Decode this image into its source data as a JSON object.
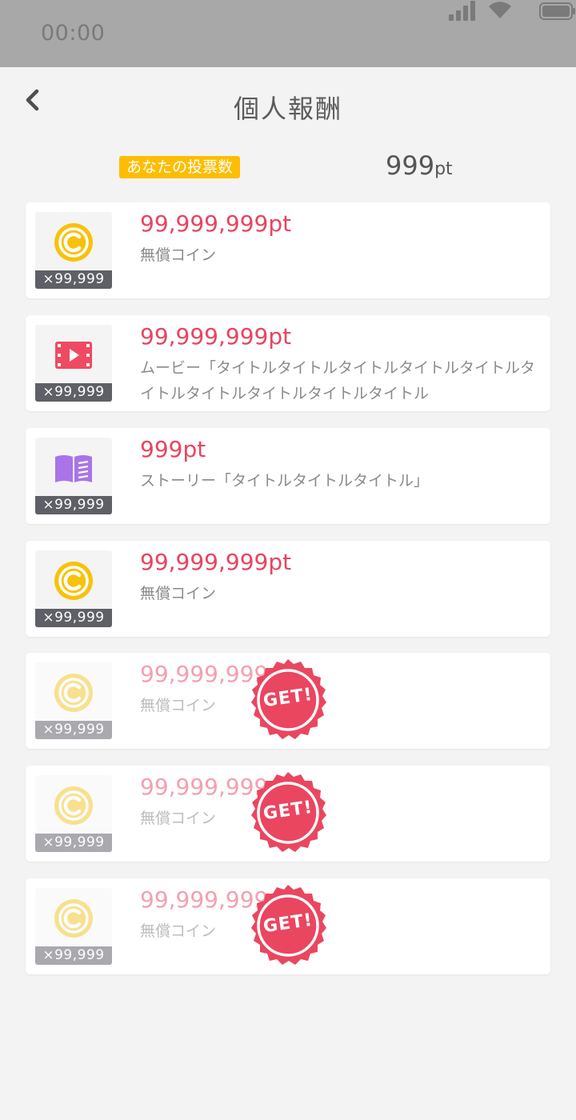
{
  "status_bar": {
    "time": "00:00"
  },
  "header": {
    "title": "個人報酬"
  },
  "votes": {
    "label": "あなたの投票数",
    "value": "999",
    "unit": "pt"
  },
  "colors": {
    "accent": "#e9445f",
    "badge": "#fdbd00",
    "coin": "#f7c20c",
    "movie": "#ee4a62",
    "story": "#a874e8"
  },
  "rewards": [
    {
      "icon": "coin-icon",
      "quantity": "×99,999",
      "points": "99,999,999pt",
      "description": "無償コイン",
      "claimed": false
    },
    {
      "icon": "movie-icon",
      "quantity": "×99,999",
      "points": "99,999,999pt",
      "description": "ムービー「タイトルタイトルタイトルタイトルタイトルタイトルタイトルタイトルタイトルタイトル",
      "claimed": false
    },
    {
      "icon": "book-icon",
      "quantity": "×99,999",
      "points": "999pt",
      "description": "ストーリー「タイトルタイトルタイトル」",
      "claimed": false
    },
    {
      "icon": "coin-icon",
      "quantity": "×99,999",
      "points": "99,999,999pt",
      "description": "無償コイン",
      "claimed": false
    },
    {
      "icon": "coin-icon",
      "quantity": "×99,999",
      "points": "99,999,999pt",
      "description": "無償コイン",
      "claimed": true,
      "stamp": "GET!"
    },
    {
      "icon": "coin-icon",
      "quantity": "×99,999",
      "points": "99,999,999pt",
      "description": "無償コイン",
      "claimed": true,
      "stamp": "GET!"
    },
    {
      "icon": "coin-icon",
      "quantity": "×99,999",
      "points": "99,999,999pt",
      "description": "無償コイン",
      "claimed": true,
      "stamp": "GET!"
    }
  ]
}
